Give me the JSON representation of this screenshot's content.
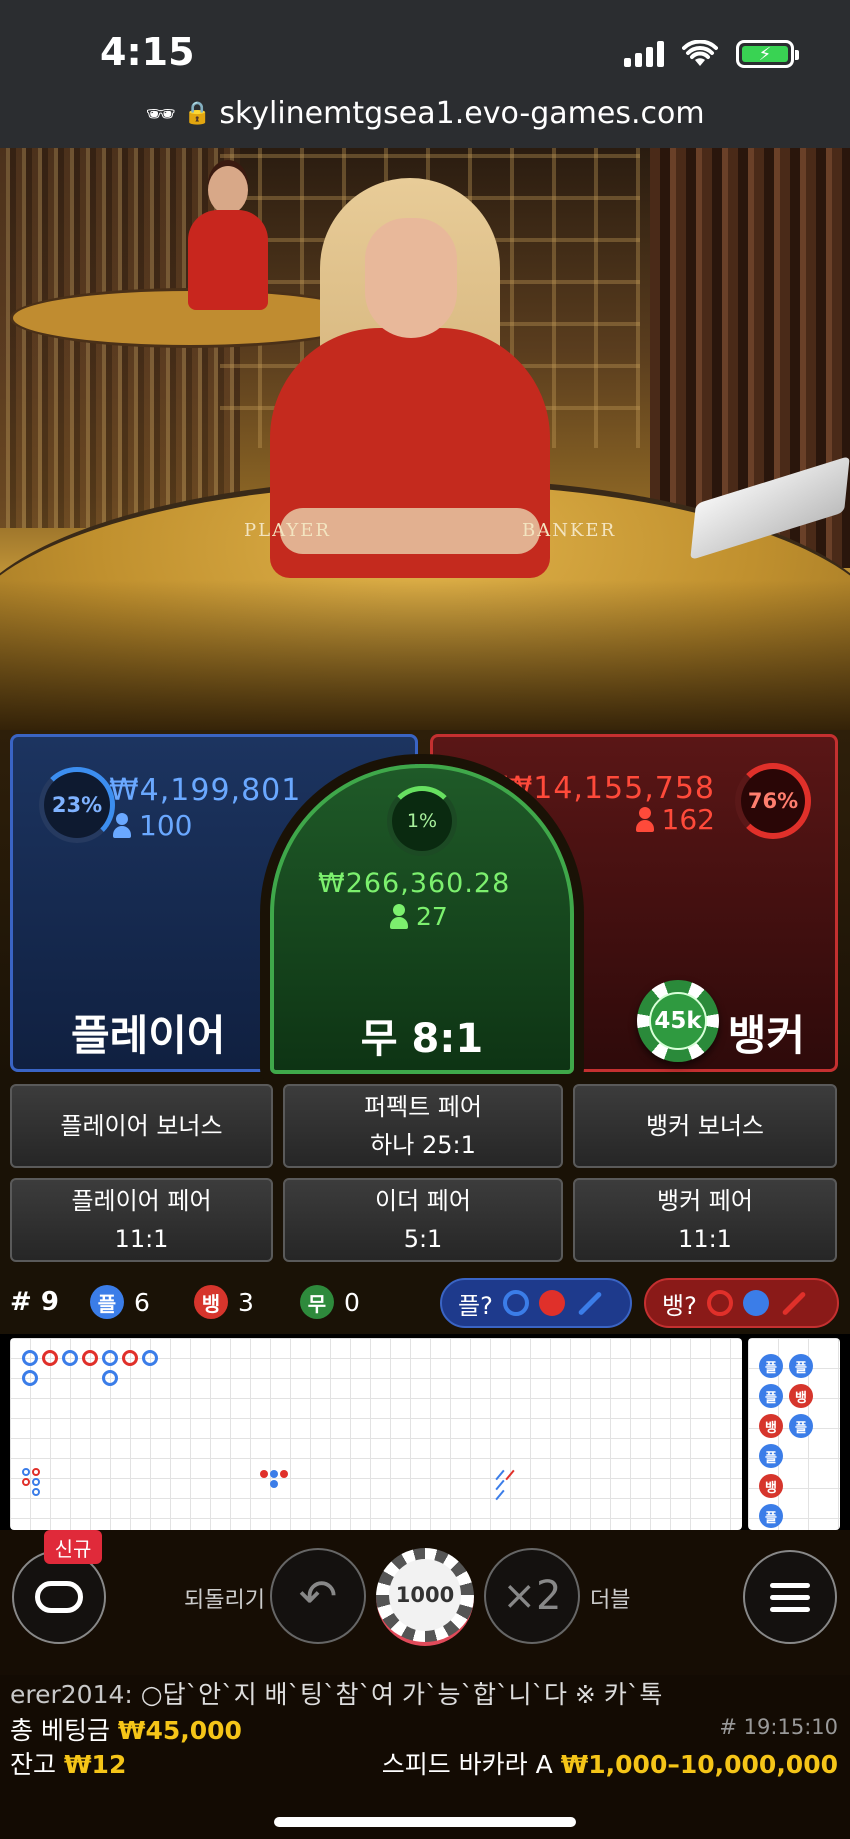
{
  "status_bar": {
    "time": "4:15",
    "battery_icon": "battery-charging-icon",
    "wifi_icon": "wifi-icon",
    "signal_icon": "cellular-signal-icon"
  },
  "browser": {
    "url": "skylinemtgsea1.evo-games.com",
    "privacy_icon": "incognito-icon",
    "lock_icon": "lock-icon"
  },
  "video": {
    "table_left": "PLAYER",
    "table_right": "BANKER"
  },
  "bets": {
    "player": {
      "label": "플레이어",
      "percent": "23%",
      "amount": "₩4,199,801",
      "players": "100",
      "color": "#3a64c4"
    },
    "tie": {
      "label": "무 8:1",
      "percent": "1%",
      "amount": "₩266,360.28",
      "players": "27",
      "color": "#3fa84a"
    },
    "banker": {
      "label": "뱅커",
      "percent": "76%",
      "amount": "₩14,155,758",
      "players": "162",
      "color": "#c43030"
    },
    "placed_chip": "45k"
  },
  "side_bets": {
    "player_bonus": "플레이어 보너스",
    "perfect_pair_line1": "퍼펙트 페어",
    "perfect_pair_line2": "하나 25:1",
    "banker_bonus": "뱅커 보너스",
    "player_pair_line1": "플레이어 페어",
    "player_pair_line2": "11:1",
    "either_pair_line1": "이더 페어",
    "either_pair_line2": "5:1",
    "banker_pair_line1": "뱅커 페어",
    "banker_pair_line2": "11:1"
  },
  "stats": {
    "round": "# 9",
    "player_badge": "플",
    "player_count": "6",
    "banker_badge": "뱅",
    "banker_count": "3",
    "tie_badge": "무",
    "tie_count": "0",
    "predict_player": "플?",
    "predict_banker": "뱅?"
  },
  "bead_road": [
    "플",
    "플",
    "플",
    "뱅",
    "뱅",
    "플",
    "플",
    "뱅",
    "플"
  ],
  "controls": {
    "new_badge": "신규",
    "undo_label": "되돌리기",
    "chip_value": "1000",
    "double_symbol": "×2",
    "double_label": "더블",
    "undo_icon": "undo-arrow-icon",
    "menu_icon": "hamburger-menu-icon",
    "lobby_icon": "lobby-icon"
  },
  "info": {
    "chat_user": "erer2014:",
    "chat_message": " ○답`안`지 배`팅`참`여 가`능`합`니`다 ※ 카`톡",
    "total_bet_label": "총 베팅금",
    "total_bet_value": "₩45,000",
    "game_id": "# 19:15:10",
    "balance_label": "잔고",
    "balance_value": "₩12",
    "table_name": "스피드 바카라 A",
    "table_limits": "₩1,000–10,000,000"
  }
}
